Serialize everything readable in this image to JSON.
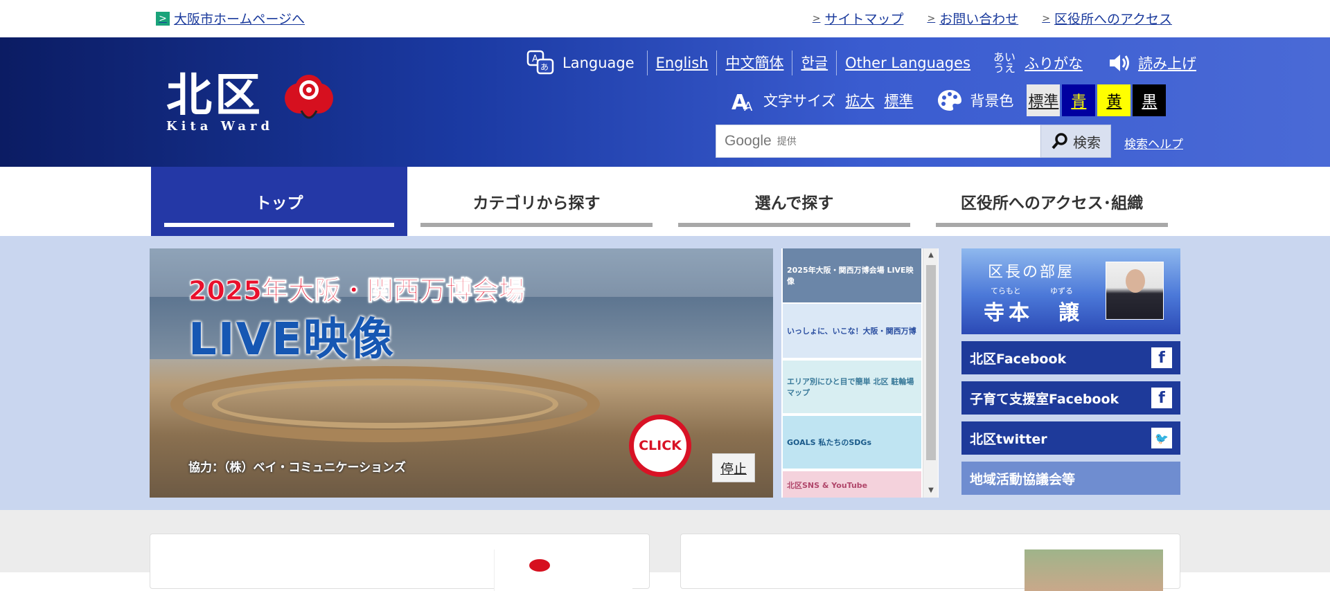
{
  "topbar": {
    "city_link": "大阪市ホームページへ",
    "links": [
      "サイトマップ",
      "お問い合わせ",
      "区役所へのアクセス"
    ]
  },
  "header": {
    "logo_kanji": "北区",
    "logo_roman": "Kita Ward",
    "language_label": "Language",
    "languages": [
      "English",
      "中文簡体",
      "한글",
      "Other Languages"
    ],
    "furigana_icon": "あい\nうえ",
    "furigana": "ふりがな",
    "yomiage": "読み上げ",
    "text_size_label": "文字サイズ",
    "size_large": "拡大",
    "size_std": "標準",
    "bg_label": "背景色",
    "bg_options": [
      {
        "label": "標準",
        "bg": "#e9e9e9",
        "fg": "#222222"
      },
      {
        "label": "青",
        "bg": "#0000a0",
        "fg": "#ffff00"
      },
      {
        "label": "黄",
        "bg": "#ffff00",
        "fg": "#000000"
      },
      {
        "label": "黒",
        "bg": "#000000",
        "fg": "#ffffff"
      }
    ],
    "search_google": "Google",
    "search_provided": "提供",
    "search_button": "検索",
    "search_help": "検索ヘルプ"
  },
  "nav": [
    "トップ",
    "カテゴリから探す",
    "選んで探す",
    "区役所へのアクセス･組織"
  ],
  "hero": {
    "line1": "2025年大阪・関西万博会場",
    "line2": "LIVE映像",
    "credit": "協力：（株）ベイ・コミュニケーションズ",
    "click": "CLICK",
    "stop": "停止"
  },
  "thumbs": [
    {
      "text": "2025年大阪・関西万博会場 LIVE映像",
      "bg": "#6b86a8",
      "fg": "#ffffff"
    },
    {
      "text": "いっしょに、いこな！大阪・関西万博",
      "bg": "#dbe8f6",
      "fg": "#2a4ea0"
    },
    {
      "text": "エリア別にひと目で簡単 北区 駐輪場マップ",
      "bg": "#d8eef2",
      "fg": "#3a7a9a"
    },
    {
      "text": "GOALS 私たちのSDGs",
      "bg": "#bfe4f2",
      "fg": "#1a5a8a"
    },
    {
      "text": "北区SNS & YouTube",
      "bg": "#f4d2dc",
      "fg": "#b0466a"
    }
  ],
  "side": {
    "mayor_title": "区長の部屋",
    "ruby_family": "てらもと",
    "ruby_given": "ゆずる",
    "mayor_name": "寺本　譲",
    "buttons": [
      {
        "label": "北区Facebook",
        "icon": "f"
      },
      {
        "label": "子育て支援室Facebook",
        "icon": "f"
      },
      {
        "label": "北区twitter",
        "icon": "t"
      },
      {
        "label": "地域活動協議会等",
        "icon": ""
      }
    ]
  }
}
